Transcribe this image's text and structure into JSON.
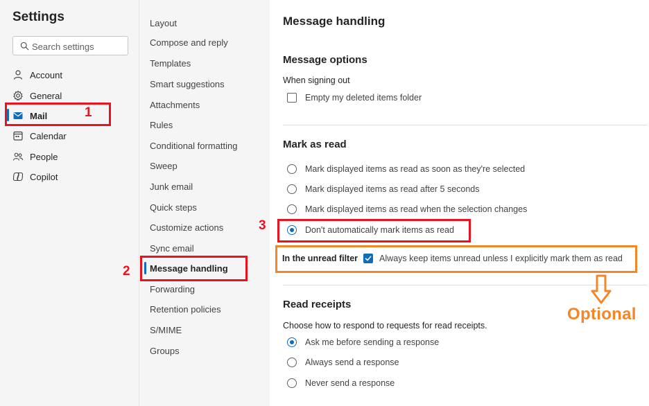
{
  "sidebar": {
    "title": "Settings",
    "search_placeholder": "Search settings",
    "items": [
      {
        "label": "Account",
        "icon": "person-icon"
      },
      {
        "label": "General",
        "icon": "gear-icon"
      },
      {
        "label": "Mail",
        "icon": "mail-icon",
        "active": true
      },
      {
        "label": "Calendar",
        "icon": "calendar-icon"
      },
      {
        "label": "People",
        "icon": "people-icon"
      },
      {
        "label": "Copilot",
        "icon": "copilot-icon"
      }
    ]
  },
  "subnav": {
    "items": [
      "Layout",
      "Compose and reply",
      "Templates",
      "Smart suggestions",
      "Attachments",
      "Rules",
      "Conditional formatting",
      "Sweep",
      "Junk email",
      "Quick steps",
      "Customize actions",
      "Sync email",
      "Message handling",
      "Forwarding",
      "Retention policies",
      "S/MIME",
      "Groups"
    ],
    "active_index": 12
  },
  "main": {
    "title": "Message handling",
    "message_options": {
      "title": "Message options",
      "sub_label": "When signing out",
      "checkbox_label": "Empty my deleted items folder",
      "checked": false
    },
    "mark_as_read": {
      "title": "Mark as read",
      "options": [
        {
          "label": "Mark displayed items as read as soon as they're selected",
          "checked": false
        },
        {
          "label": "Mark displayed items as read after 5 seconds",
          "checked": false
        },
        {
          "label": "Mark displayed items as read when the selection changes",
          "checked": false
        },
        {
          "label": "Don't automatically mark items as read",
          "checked": true
        }
      ],
      "unread_filter_label": "In the unread filter",
      "unread_filter_checkbox": "Always keep items unread unless I explicitly mark them as read",
      "unread_filter_checked": true
    },
    "read_receipts": {
      "title": "Read receipts",
      "description": "Choose how to respond to requests for read receipts.",
      "options": [
        {
          "label": "Ask me before sending a response",
          "checked": true
        },
        {
          "label": "Always send a response",
          "checked": false
        },
        {
          "label": "Never send a response",
          "checked": false
        }
      ]
    }
  },
  "annotations": {
    "step1": "1",
    "step2": "2",
    "step3": "3",
    "optional": "Optional",
    "red": "#e8131d",
    "orange": "#f4862a"
  },
  "colors": {
    "accent": "#0f6cbd",
    "nav_bg": "#f5f5f5"
  }
}
